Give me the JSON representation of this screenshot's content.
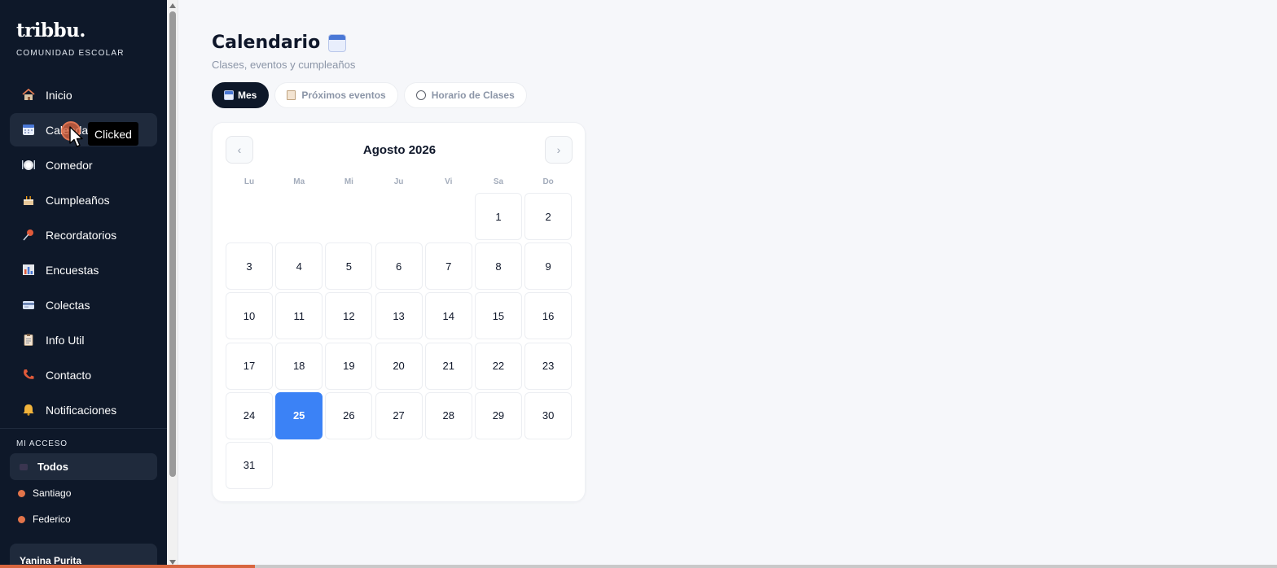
{
  "brand": {
    "name": "tribbu.",
    "subtitle": "COMUNIDAD ESCOLAR"
  },
  "sidebar": {
    "items": [
      {
        "label": "Inicio",
        "icon": "house-icon",
        "active": false
      },
      {
        "label": "Calendario",
        "icon": "calendar-icon",
        "active": true
      },
      {
        "label": "Comedor",
        "icon": "plate-icon",
        "active": false
      },
      {
        "label": "Cumpleaños",
        "icon": "cake-icon",
        "active": false
      },
      {
        "label": "Recordatorios",
        "icon": "pushpin-icon",
        "active": false
      },
      {
        "label": "Encuestas",
        "icon": "bar-chart-icon",
        "active": false
      },
      {
        "label": "Colectas",
        "icon": "credit-card-icon",
        "active": false
      },
      {
        "label": "Info Util",
        "icon": "clipboard-icon",
        "active": false
      },
      {
        "label": "Contacto",
        "icon": "phone-icon",
        "active": false
      },
      {
        "label": "Notificaciones",
        "icon": "bell-icon",
        "active": false
      }
    ],
    "access_title": "MI ACCESO",
    "access_all": "Todos",
    "children": [
      "Santiago",
      "Federico"
    ],
    "user_name": "Yanina Purita"
  },
  "main": {
    "title": "Calendario",
    "subtitle": "Clases, eventos y cumpleaños",
    "tabs": [
      {
        "label": "Mes",
        "icon": "calendar-icon",
        "active": true
      },
      {
        "label": "Próximos eventos",
        "icon": "clipboard-icon",
        "active": false
      },
      {
        "label": "Horario de Clases",
        "icon": "clock-icon",
        "active": false
      }
    ]
  },
  "calendar": {
    "month_label": "Agosto 2026",
    "prev_label": "‹",
    "next_label": "›",
    "weekdays": [
      "Lu",
      "Ma",
      "Mi",
      "Ju",
      "Vi",
      "Sa",
      "Do"
    ],
    "leading_blank_days": 5,
    "days_in_month": 31,
    "today": 25
  },
  "overlay": {
    "tooltip": "Clicked"
  },
  "colors": {
    "sidebar_bg": "#0e1829",
    "sidebar_active": "#1f2a3c",
    "accent_blue": "#3b82f6",
    "child_dot": "#e2744a",
    "progress": "#d8663f"
  }
}
